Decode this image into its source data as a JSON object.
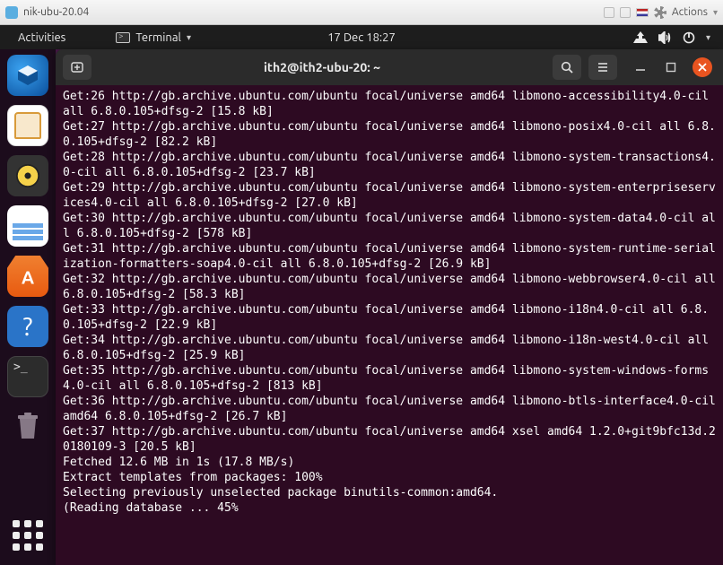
{
  "vm": {
    "title": "nik-ubu-20.04",
    "actions_label": "Actions"
  },
  "gnome": {
    "activities": "Activities",
    "app_name": "Terminal",
    "clock": "17 Dec  18:27"
  },
  "dock": {
    "items": [
      {
        "name": "thunderbird-icon"
      },
      {
        "name": "files-icon"
      },
      {
        "name": "rhythmbox-icon"
      },
      {
        "name": "libreoffice-writer-icon"
      },
      {
        "name": "ubuntu-software-icon"
      },
      {
        "name": "help-icon"
      },
      {
        "name": "terminal-icon"
      },
      {
        "name": "trash-icon"
      }
    ]
  },
  "terminal": {
    "title": "ith2@ith2-ubu-20: ~",
    "lines": [
      "Get:26 http://gb.archive.ubuntu.com/ubuntu focal/universe amd64 libmono-accessibility4.0-cil all 6.8.0.105+dfsg-2 [15.8 kB]",
      "Get:27 http://gb.archive.ubuntu.com/ubuntu focal/universe amd64 libmono-posix4.0-cil all 6.8.0.105+dfsg-2 [82.2 kB]",
      "Get:28 http://gb.archive.ubuntu.com/ubuntu focal/universe amd64 libmono-system-transactions4.0-cil all 6.8.0.105+dfsg-2 [23.7 kB]",
      "Get:29 http://gb.archive.ubuntu.com/ubuntu focal/universe amd64 libmono-system-enterpriseservices4.0-cil all 6.8.0.105+dfsg-2 [27.0 kB]",
      "Get:30 http://gb.archive.ubuntu.com/ubuntu focal/universe amd64 libmono-system-data4.0-cil all 6.8.0.105+dfsg-2 [578 kB]",
      "Get:31 http://gb.archive.ubuntu.com/ubuntu focal/universe amd64 libmono-system-runtime-serialization-formatters-soap4.0-cil all 6.8.0.105+dfsg-2 [26.9 kB]",
      "Get:32 http://gb.archive.ubuntu.com/ubuntu focal/universe amd64 libmono-webbrowser4.0-cil all 6.8.0.105+dfsg-2 [58.3 kB]",
      "Get:33 http://gb.archive.ubuntu.com/ubuntu focal/universe amd64 libmono-i18n4.0-cil all 6.8.0.105+dfsg-2 [22.9 kB]",
      "Get:34 http://gb.archive.ubuntu.com/ubuntu focal/universe amd64 libmono-i18n-west4.0-cil all 6.8.0.105+dfsg-2 [25.9 kB]",
      "Get:35 http://gb.archive.ubuntu.com/ubuntu focal/universe amd64 libmono-system-windows-forms4.0-cil all 6.8.0.105+dfsg-2 [813 kB]",
      "Get:36 http://gb.archive.ubuntu.com/ubuntu focal/universe amd64 libmono-btls-interface4.0-cil amd64 6.8.0.105+dfsg-2 [26.7 kB]",
      "Get:37 http://gb.archive.ubuntu.com/ubuntu focal/universe amd64 xsel amd64 1.2.0+git9bfc13d.20180109-3 [20.5 kB]",
      "Fetched 12.6 MB in 1s (17.8 MB/s)",
      "Extract templates from packages: 100%",
      "Selecting previously unselected package binutils-common:amd64.",
      "(Reading database ... 45%"
    ]
  }
}
